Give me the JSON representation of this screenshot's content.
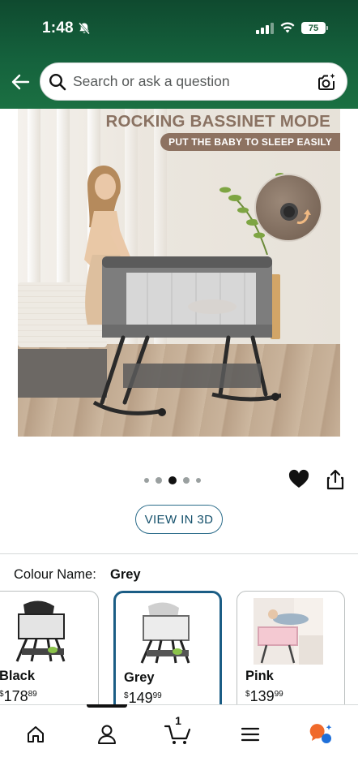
{
  "status_bar": {
    "time": "1:48",
    "battery": "75",
    "icons": [
      "bell-off-icon",
      "signal-icon",
      "wifi-icon",
      "battery-icon"
    ]
  },
  "header": {
    "back_icon": "back-arrow-icon",
    "search_placeholder": "Search or ask a question",
    "camera_icon": "camera-search-icon",
    "bg_color": "#15623d"
  },
  "hero": {
    "headline": "ROCKING BASSINET MODE",
    "subtag": "PUT THE BABY TO SLEEP EASILY",
    "accent": "#8d7261"
  },
  "carousel": {
    "dots": 5,
    "active_index": 2
  },
  "actions": {
    "heart_icon": "heart-icon",
    "share_icon": "share-icon",
    "view_3d_label": "VIEW IN 3D"
  },
  "colour": {
    "label": "Colour Name:",
    "selected": "Grey"
  },
  "swatches": [
    {
      "name": "Black",
      "currency": "$",
      "whole": "178",
      "cents": "89",
      "selected": false
    },
    {
      "name": "Grey",
      "currency": "$",
      "whole": "149",
      "cents": "99",
      "selected": true
    },
    {
      "name": "Pink",
      "currency": "$",
      "whole": "139",
      "cents": "99",
      "selected": false
    }
  ],
  "bottom_nav": {
    "items": [
      "home-icon",
      "account-icon",
      "cart-icon",
      "menu-icon",
      "rufus-icon"
    ],
    "active": "account-icon",
    "cart_count": "1"
  }
}
